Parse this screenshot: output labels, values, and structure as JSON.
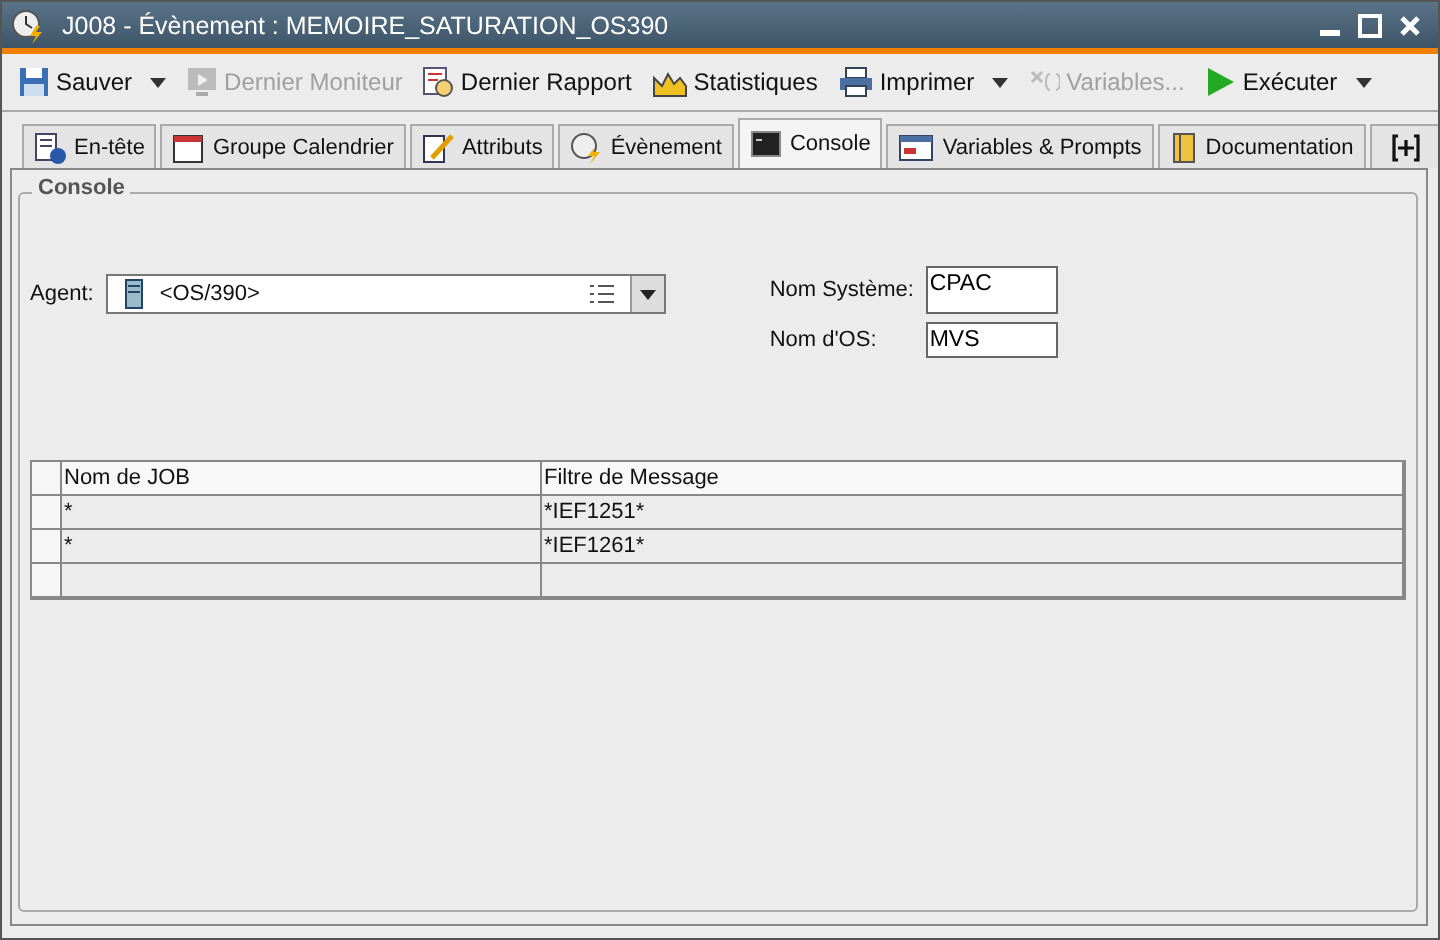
{
  "window": {
    "title": "J008 - Évènement : MEMOIRE_SATURATION_OS390"
  },
  "toolbar": [
    {
      "label": "Sauver",
      "disabled": false,
      "dropdown": true
    },
    {
      "label": "Dernier Moniteur",
      "disabled": true,
      "dropdown": false
    },
    {
      "label": "Dernier Rapport",
      "disabled": false,
      "dropdown": false
    },
    {
      "label": "Statistiques",
      "disabled": false,
      "dropdown": false
    },
    {
      "label": "Imprimer",
      "disabled": false,
      "dropdown": true
    },
    {
      "label": "Variables...",
      "disabled": true,
      "dropdown": false
    },
    {
      "label": "Exécuter",
      "disabled": false,
      "dropdown": true
    }
  ],
  "tabs": [
    {
      "label": "En-tête",
      "selected": false
    },
    {
      "label": "Groupe Calendrier",
      "selected": false
    },
    {
      "label": "Attributs",
      "selected": false
    },
    {
      "label": "Évènement",
      "selected": false
    },
    {
      "label": "Console",
      "selected": true
    },
    {
      "label": "Variables & Prompts",
      "selected": false
    },
    {
      "label": "Documentation",
      "selected": false
    }
  ],
  "panel": {
    "title": "Console",
    "agent": {
      "label": "Agent:",
      "value": "<OS/390>"
    },
    "system_name": {
      "label": "Nom Système:",
      "value": "CPAC"
    },
    "os_name": {
      "label": "Nom d'OS:",
      "value": "MVS"
    },
    "table": {
      "columns": [
        "Nom de JOB",
        "Filtre de Message"
      ],
      "rows": [
        [
          "*",
          "*IEF1251*"
        ],
        [
          "*",
          "*IEF1261*"
        ],
        [
          "",
          ""
        ]
      ]
    }
  }
}
